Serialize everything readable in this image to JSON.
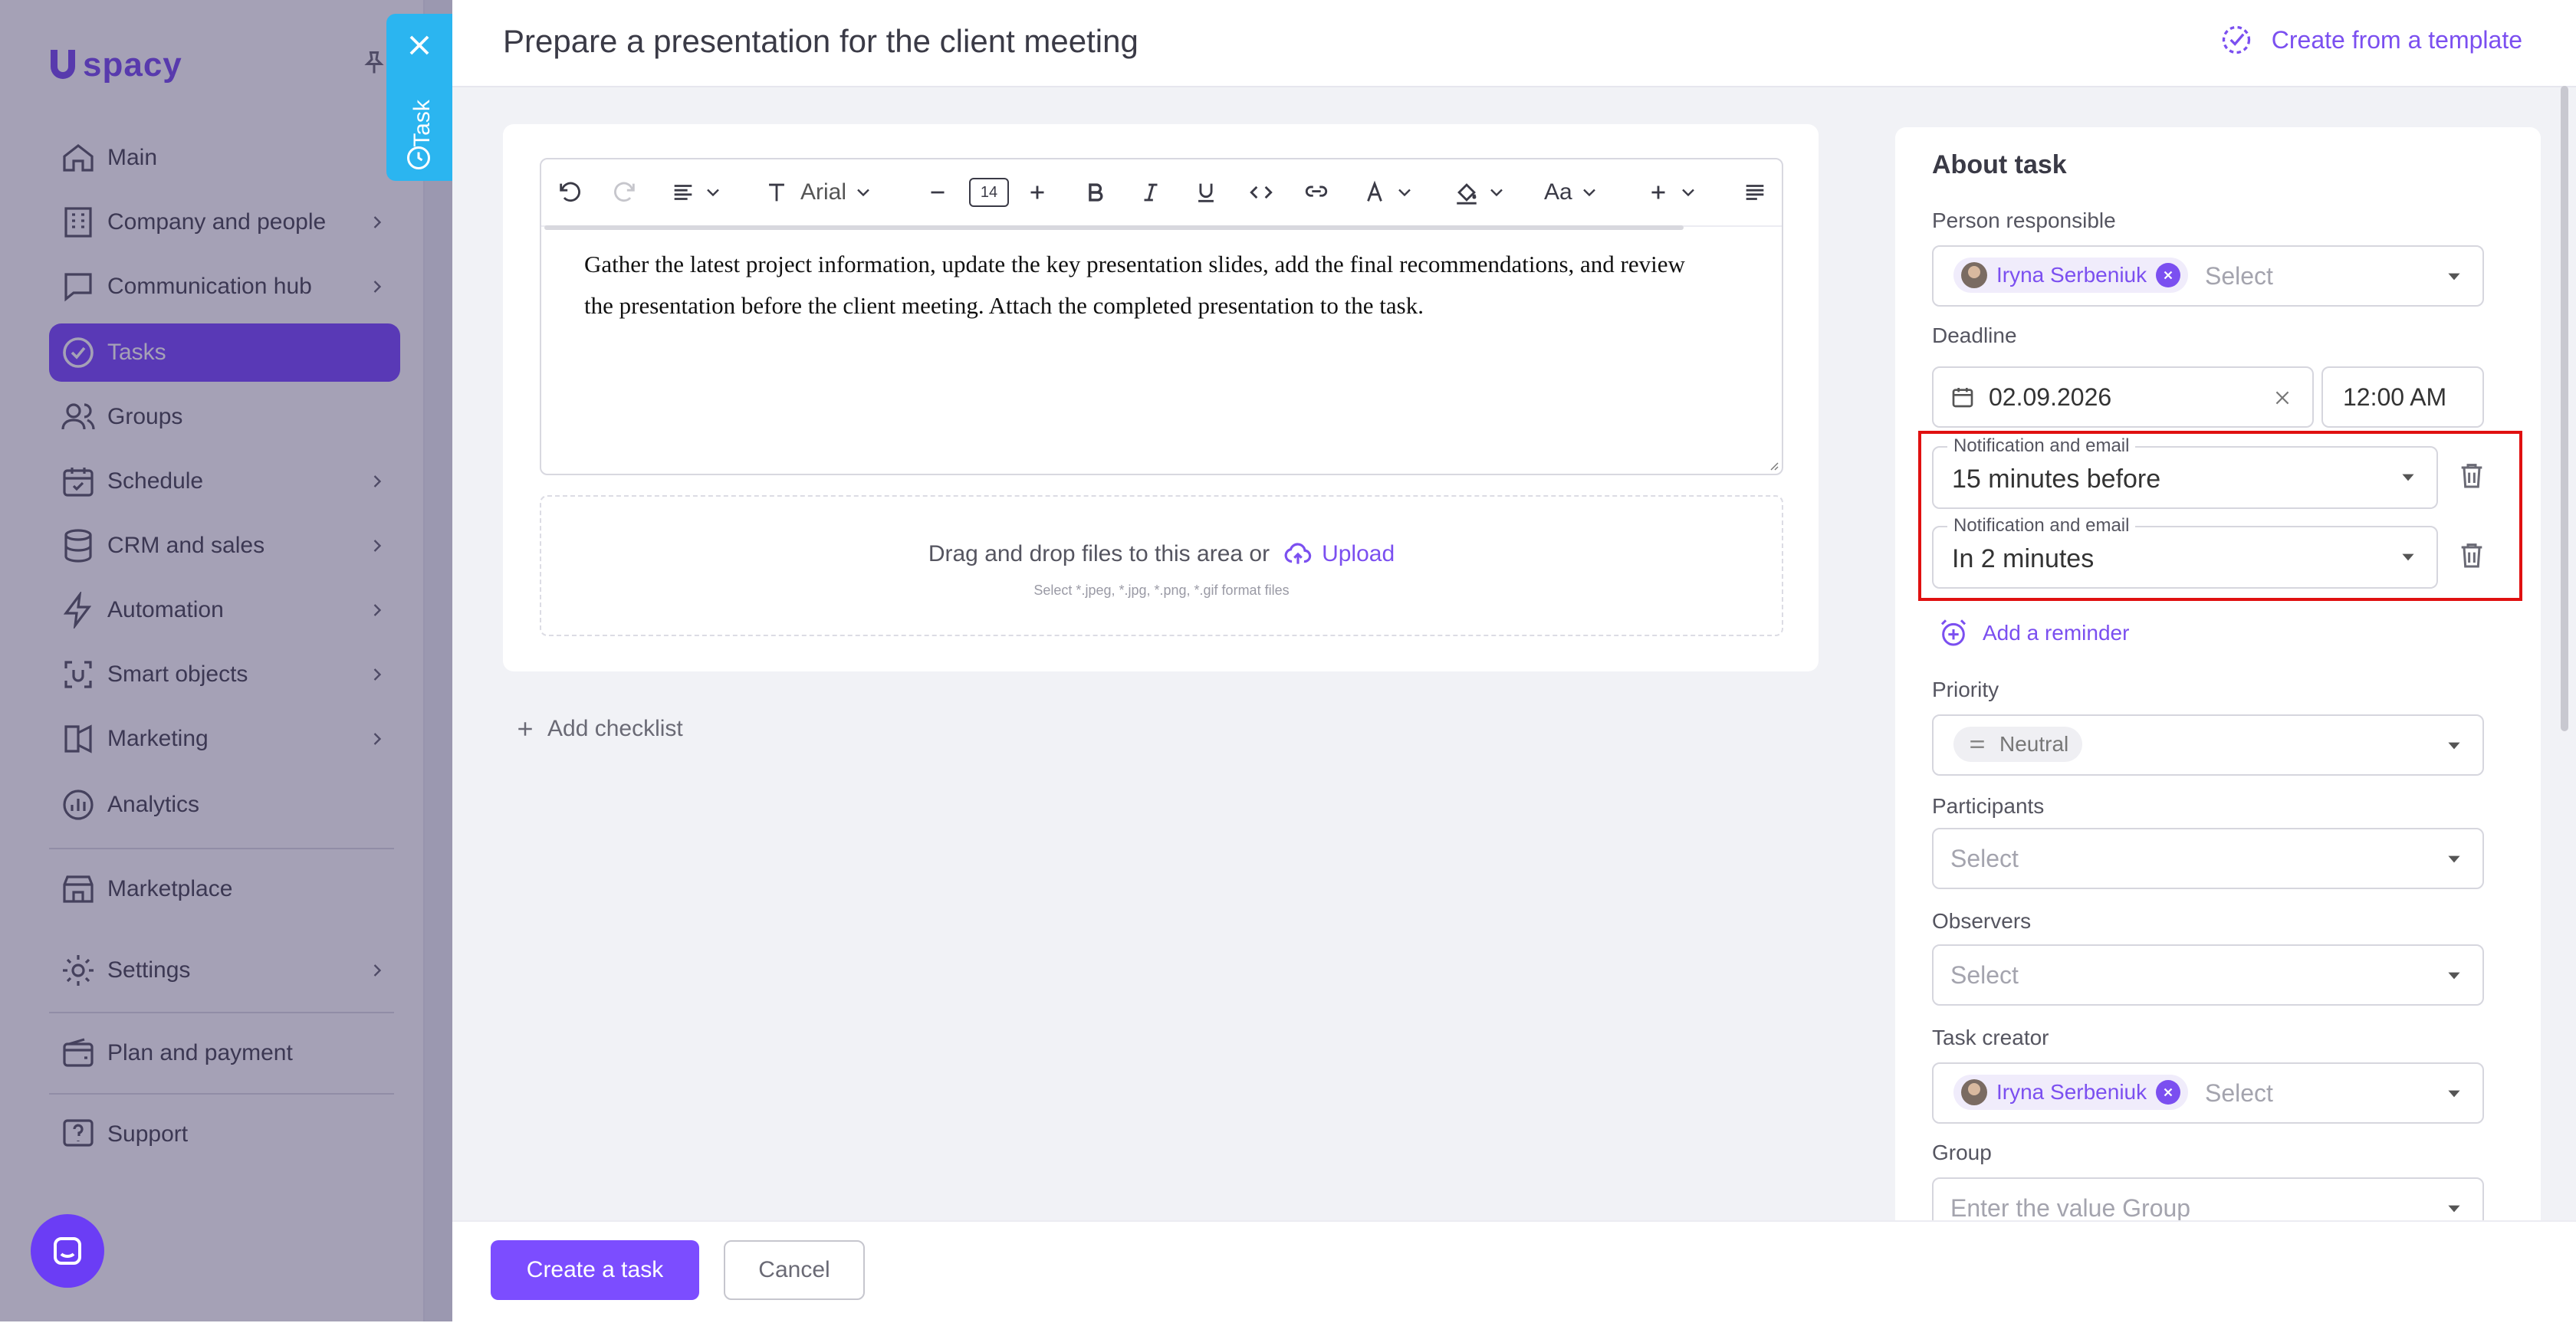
{
  "sidebar": {
    "logo_text": "spacy",
    "items": [
      {
        "label": "Main",
        "icon": "home-icon",
        "chevron": false
      },
      {
        "label": "Company and people",
        "icon": "building-icon",
        "chevron": true
      },
      {
        "label": "Communication hub",
        "icon": "chat-icon",
        "chevron": true
      },
      {
        "label": "Tasks",
        "icon": "check-circle-icon",
        "chevron": false,
        "active": true
      },
      {
        "label": "Groups",
        "icon": "users-icon",
        "chevron": false
      },
      {
        "label": "Schedule",
        "icon": "calendar-icon",
        "chevron": true
      },
      {
        "label": "CRM and sales",
        "icon": "database-icon",
        "chevron": true
      },
      {
        "label": "Automation",
        "icon": "lightning-icon",
        "chevron": true
      },
      {
        "label": "Smart objects",
        "icon": "smart-object-icon",
        "chevron": true
      },
      {
        "label": "Marketing",
        "icon": "marketing-icon",
        "chevron": true
      },
      {
        "label": "Analytics",
        "icon": "analytics-icon",
        "chevron": false
      },
      {
        "label": "Marketplace",
        "icon": "marketplace-icon",
        "chevron": false
      },
      {
        "label": "Settings",
        "icon": "gear-icon",
        "chevron": true
      },
      {
        "label": "Plan and payment",
        "icon": "wallet-icon",
        "chevron": false
      },
      {
        "label": "Support",
        "icon": "help-icon",
        "chevron": false
      }
    ]
  },
  "task_tab": {
    "label": "Task"
  },
  "header": {
    "title": "Prepare a presentation for the client meeting",
    "template_label": "Create from a template"
  },
  "editor": {
    "font": "Arial",
    "font_size": "14",
    "body": "Gather the latest project information, update the key presentation slides, add the final recommendations, and review the presentation before the client meeting. Attach the completed presentation to the task."
  },
  "dropzone": {
    "text": "Drag and drop files to this area or",
    "upload_label": "Upload",
    "hint": "Select *.jpeg, *.jpg, *.png, *.gif format files"
  },
  "checklist": {
    "add_label": "Add checklist"
  },
  "about": {
    "title": "About task",
    "person_responsible": {
      "label": "Person responsible",
      "chip": "Iryna Serbeniuk",
      "placeholder": "Select"
    },
    "deadline": {
      "label": "Deadline",
      "date": "02.09.2026",
      "time": "12:00 AM"
    },
    "reminders": [
      {
        "legend": "Notification and email",
        "value": "15 minutes before"
      },
      {
        "legend": "Notification and email",
        "value": "In 2 minutes"
      }
    ],
    "add_reminder": "Add a reminder",
    "priority": {
      "label": "Priority",
      "value": "Neutral"
    },
    "participants": {
      "label": "Participants",
      "placeholder": "Select"
    },
    "observers": {
      "label": "Observers",
      "placeholder": "Select"
    },
    "task_creator": {
      "label": "Task creator",
      "chip": "Iryna Serbeniuk",
      "placeholder": "Select"
    },
    "group": {
      "label": "Group",
      "placeholder": "Enter the value Group"
    }
  },
  "footer": {
    "create_label": "Create a task",
    "cancel_label": "Cancel"
  },
  "colors": {
    "accent": "#7c4dff",
    "tab": "#2bb5f0",
    "highlight": "#e01010"
  }
}
